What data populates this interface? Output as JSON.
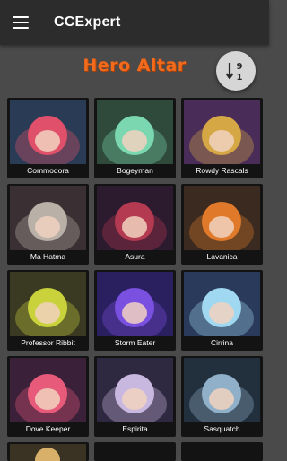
{
  "appbar": {
    "title": "CCExpert",
    "menu_icon": "hamburger-menu-icon"
  },
  "page": {
    "title": "Hero Altar"
  },
  "sort": {
    "icon": "sort-numeric-desc-icon",
    "top_digit": "9",
    "bottom_digit": "1"
  },
  "heroes": [
    {
      "name": "Commodora",
      "colors": {
        "bg": "#2a3b55",
        "accent": "#e0506a"
      }
    },
    {
      "name": "Bogeyman",
      "colors": {
        "bg": "#2f4a3a",
        "accent": "#7ad7b0"
      }
    },
    {
      "name": "Rowdy Rascals",
      "colors": {
        "bg": "#4a2c58",
        "accent": "#d6a845"
      }
    },
    {
      "name": "Ma Hatma",
      "colors": {
        "bg": "#3a3033",
        "accent": "#b9b0a8"
      }
    },
    {
      "name": "Asura",
      "colors": {
        "bg": "#2c1a2e",
        "accent": "#b43a52"
      }
    },
    {
      "name": "Lavanica",
      "colors": {
        "bg": "#3a2a1f",
        "accent": "#e07a2a"
      }
    },
    {
      "name": "Professor Ribbit",
      "colors": {
        "bg": "#3a3a22",
        "accent": "#c9d23a"
      }
    },
    {
      "name": "Storm Eater",
      "colors": {
        "bg": "#2a2060",
        "accent": "#7a50e0"
      }
    },
    {
      "name": "Cirrina",
      "colors": {
        "bg": "#2a3a5a",
        "accent": "#9fd8f0"
      }
    },
    {
      "name": "Dove Keeper",
      "colors": {
        "bg": "#3a2038",
        "accent": "#e85a7a"
      }
    },
    {
      "name": "Espirita",
      "colors": {
        "bg": "#2e2840",
        "accent": "#c8b8e0"
      }
    },
    {
      "name": "Sasquatch",
      "colors": {
        "bg": "#22303e",
        "accent": "#8fb0c8"
      }
    }
  ],
  "colors": {
    "appbar": "#2c2c2c",
    "background": "#4a4a4a",
    "title": "#f26a1b",
    "card": "#131313"
  }
}
